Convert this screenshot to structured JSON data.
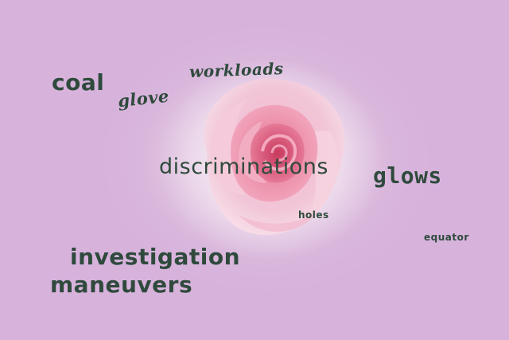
{
  "image": {
    "background_color": "#d7b3dc",
    "text_color": "#2f4a3c",
    "subject": "pink-rose"
  },
  "words": {
    "coal": "coal",
    "glove": "glove",
    "workloads": "workloads",
    "discriminations": "discriminations",
    "glows": "glows",
    "holes": "holes",
    "equator": "equator",
    "investigation": "investigation",
    "maneuvers": "maneuvers"
  }
}
